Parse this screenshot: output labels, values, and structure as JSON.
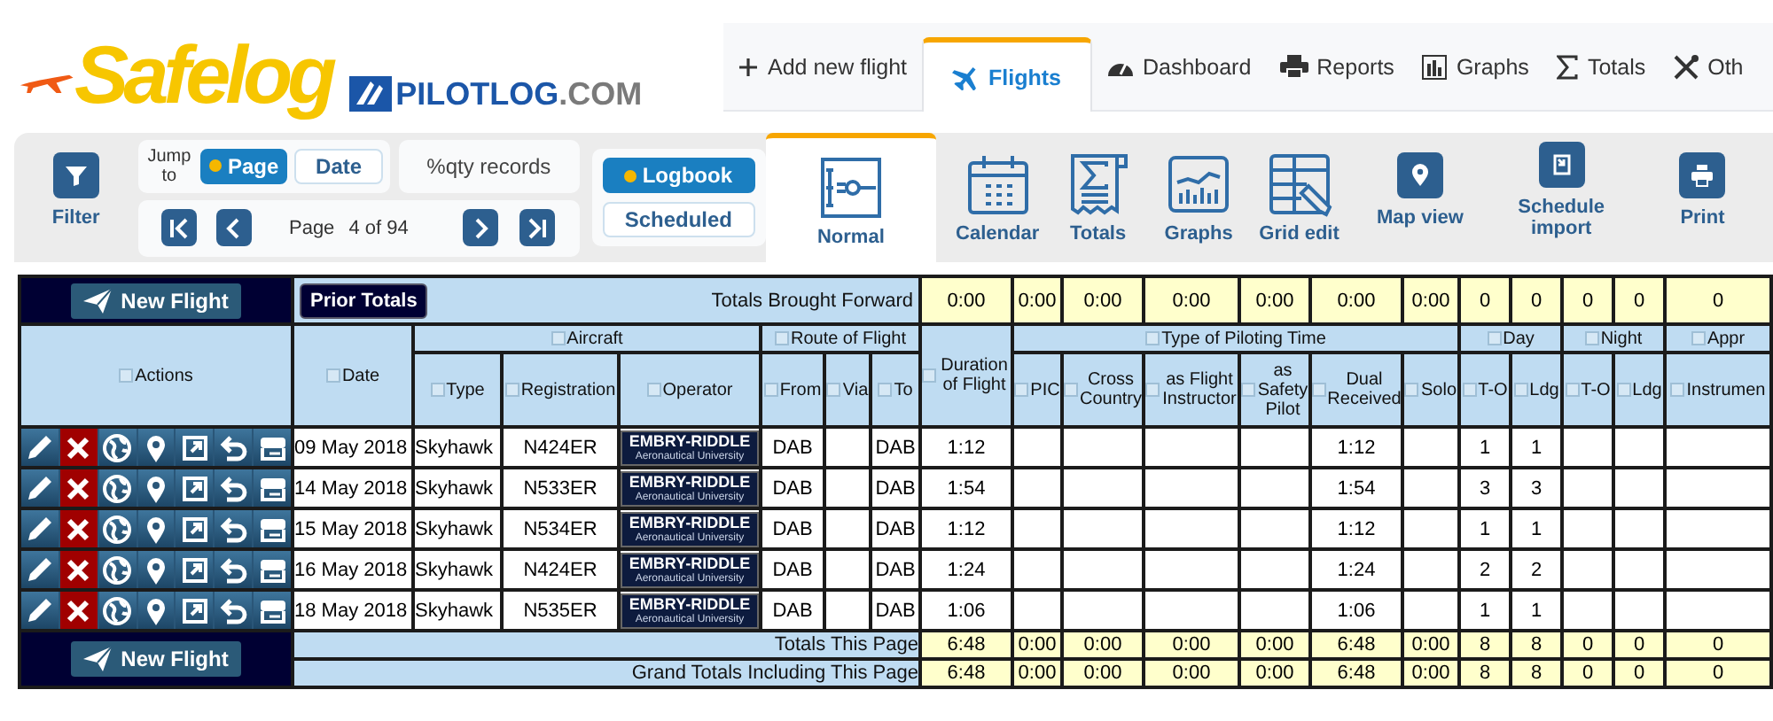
{
  "logo": {
    "title": "Safelog",
    "brand": "PILOTLOG",
    "brand_suffix": ".COM"
  },
  "nav_tabs": [
    {
      "label": "Add new flight",
      "selected": false
    },
    {
      "label": "Flights",
      "selected": true
    },
    {
      "label": "Dashboard",
      "selected": false
    },
    {
      "label": "Reports",
      "selected": false
    },
    {
      "label": "Graphs",
      "selected": false
    },
    {
      "label": "Totals",
      "selected": false
    },
    {
      "label": "Oth",
      "selected": false
    }
  ],
  "toolbar": {
    "filter": "Filter",
    "jump_label": "Jump to",
    "jump_options": [
      {
        "label": "Page",
        "selected": true
      },
      {
        "label": "Date",
        "selected": false
      }
    ],
    "records": "%qty records",
    "pager_label": "Page",
    "pager_value": "4 of 94",
    "modes": [
      {
        "label": "Logbook",
        "selected": true
      },
      {
        "label": "Scheduled",
        "selected": false
      }
    ],
    "views": [
      {
        "label": "Normal",
        "selected": true
      },
      {
        "label": "Calendar",
        "selected": false
      },
      {
        "label": "Totals",
        "selected": false
      },
      {
        "label": "Graphs",
        "selected": false
      },
      {
        "label": "Grid edit",
        "selected": false
      }
    ],
    "actions": [
      "Map view",
      "Schedule import",
      "Print"
    ]
  },
  "table": {
    "top": {
      "new_flight": "New Flight",
      "prior_totals": "Prior Totals",
      "label": "Totals Brought Forward",
      "values": [
        "0:00",
        "0:00",
        "0:00",
        "0:00",
        "0:00",
        "0:00",
        "0:00",
        "0",
        "0",
        "0",
        "0",
        "0"
      ]
    },
    "header": [
      {
        "label": "Actions"
      },
      {
        "label": "Date"
      },
      {
        "label": "Aircraft",
        "children": [
          {
            "label": "Type"
          },
          {
            "label": "Registration"
          },
          {
            "label": "Operator"
          }
        ]
      },
      {
        "label": "Route of Flight",
        "children": [
          {
            "label": "From"
          },
          {
            "label": "Via"
          },
          {
            "label": "To"
          }
        ]
      },
      {
        "label": "Duration of Flight"
      },
      {
        "label": "Type of Piloting Time",
        "children": [
          {
            "label": "PIC"
          },
          {
            "label": "Cross Country"
          },
          {
            "label": "as Flight Instructor"
          },
          {
            "label": "as Safety Pilot"
          },
          {
            "label": "Dual Received"
          },
          {
            "label": "Solo"
          }
        ]
      },
      {
        "label": "Day",
        "children": [
          {
            "label": "T-O"
          },
          {
            "label": "Ldg"
          }
        ]
      },
      {
        "label": "Night",
        "children": [
          {
            "label": "T-O"
          },
          {
            "label": "Ldg"
          }
        ]
      },
      {
        "label": "Appr",
        "children": [
          {
            "label": "Instrumen"
          }
        ]
      }
    ],
    "rows": [
      {
        "date": "09 May 2018",
        "type": "Skyhawk",
        "registration": "N424ER",
        "operator": {
          "name": "EMBRY-RIDDLE",
          "subtitle": "Aeronautical University"
        },
        "from": "DAB",
        "to": "DAB",
        "duration": "1:12",
        "dual_received": "1:12",
        "day_to": "1",
        "day_ldg": "1"
      },
      {
        "date": "14 May 2018",
        "type": "Skyhawk",
        "registration": "N533ER",
        "operator": {
          "name": "EMBRY-RIDDLE",
          "subtitle": "Aeronautical University"
        },
        "from": "DAB",
        "to": "DAB",
        "duration": "1:54",
        "dual_received": "1:54",
        "day_to": "3",
        "day_ldg": "3"
      },
      {
        "date": "15 May 2018",
        "type": "Skyhawk",
        "registration": "N534ER",
        "operator": {
          "name": "EMBRY-RIDDLE",
          "subtitle": "Aeronautical University"
        },
        "from": "DAB",
        "to": "DAB",
        "duration": "1:12",
        "dual_received": "1:12",
        "day_to": "1",
        "day_ldg": "1"
      },
      {
        "date": "16 May 2018",
        "type": "Skyhawk",
        "registration": "N424ER",
        "operator": {
          "name": "EMBRY-RIDDLE",
          "subtitle": "Aeronautical University"
        },
        "from": "DAB",
        "to": "DAB",
        "duration": "1:24",
        "dual_received": "1:24",
        "day_to": "2",
        "day_ldg": "2"
      },
      {
        "date": "18 May 2018",
        "type": "Skyhawk",
        "registration": "N535ER",
        "operator": {
          "name": "EMBRY-RIDDLE",
          "subtitle": "Aeronautical University"
        },
        "from": "DAB",
        "to": "DAB",
        "duration": "1:06",
        "dual_received": "1:06",
        "day_to": "1",
        "day_ldg": "1"
      }
    ],
    "footer": {
      "new_flight": "New Flight",
      "totals": [
        {
          "label": "Totals This Page",
          "values": [
            "6:48",
            "0:00",
            "0:00",
            "0:00",
            "0:00",
            "6:48",
            "0:00",
            "8",
            "8",
            "0",
            "0",
            "0"
          ]
        },
        {
          "label": "Grand Totals Including This Page",
          "values": [
            "6:48",
            "0:00",
            "0:00",
            "0:00",
            "0:00",
            "6:48",
            "0:00",
            "8",
            "8",
            "0",
            "0",
            "0"
          ]
        }
      ]
    }
  }
}
